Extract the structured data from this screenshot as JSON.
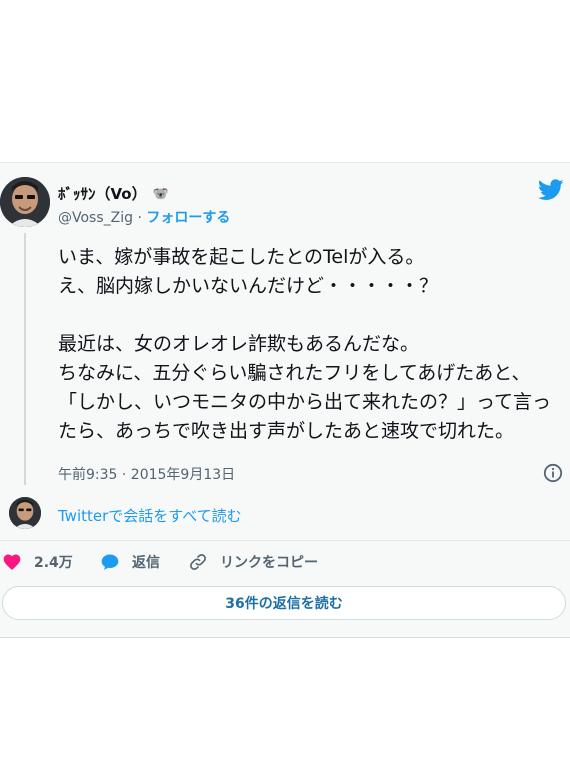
{
  "tweet": {
    "display_name": "ﾎﾞｯｻﾝ（Vo）",
    "emoji": "🐨",
    "handle": "@Voss_Zig",
    "separator": "·",
    "follow_label": "フォローする",
    "paragraph1": "いま、嫁が事故を起こしたとのTelが入る。\nえ、脳内嫁しかいないんだけど・・・・・？",
    "paragraph2": "最近は、女のオレオレ詐欺もあるんだな。\nちなみに、五分ぐらい騙されたフリをしてあげたあと、「しかし、いつモニタの中から出て来れたの？」って言ったら、あっちで吹き出す声がしたあと速攻で切れた。",
    "timestamp": "午前9:35 · 2015年9月13日"
  },
  "conversation_link": "Twitterで会話をすべて読む",
  "actions": {
    "like_count": "2.4万",
    "reply_label": "返信",
    "copy_link_label": "リンクをコピー"
  },
  "read_replies_label": "36件の返信を読む",
  "colors": {
    "accent": "#1d9bf0",
    "like": "#f91880",
    "background": "#f7f9f9",
    "text": "#0f1419",
    "muted": "#536471"
  },
  "icons": [
    "twitter-bird-icon",
    "info-icon",
    "heart-icon",
    "reply-bubble-icon",
    "link-icon",
    "koala-emoji"
  ]
}
